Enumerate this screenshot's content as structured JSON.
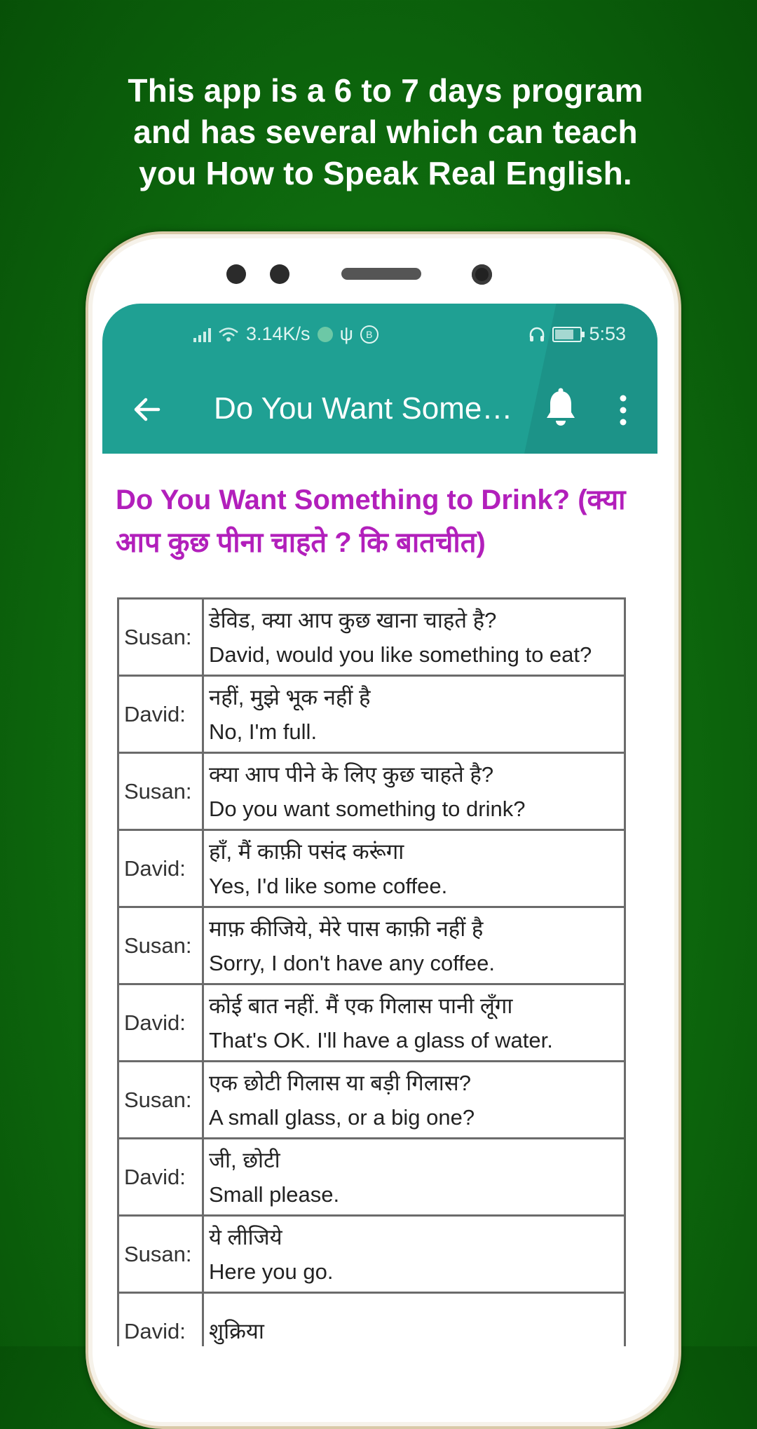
{
  "promo": {
    "line1": "This app is a 6 to 7 days program",
    "line2": "and has several which can teach",
    "line3": "you How to Speak Real English."
  },
  "statusbar": {
    "speed": "3.14K/s",
    "time": "5:53",
    "icons": [
      "signal-icon",
      "wifi-icon",
      "vpn-icon",
      "usb-icon",
      "b-icon",
      "headset-icon",
      "battery-icon"
    ]
  },
  "toolbar": {
    "title": "Do You Want Somet...",
    "back_icon": "back-arrow-icon",
    "bell_icon": "bell-icon",
    "menu_icon": "more-vert-icon"
  },
  "content": {
    "heading": "Do You Want Something to Drink? (क्या आप कुछ पीना चाहते ? कि बातचीत)",
    "dialog": [
      {
        "speaker": "Susan:",
        "hindi": "डेविड, क्या आप कुछ खाना चाहते है?",
        "english": "David, would you like something to eat?"
      },
      {
        "speaker": "David:",
        "hindi": "नहीं, मुझे भूक नहीं है",
        "english": "No, I'm full."
      },
      {
        "speaker": "Susan:",
        "hindi": "क्या आप पीने के लिए कुछ चाहते है?",
        "english": "Do you want something to drink?"
      },
      {
        "speaker": "David:",
        "hindi": "हाँ, मैं काफ़ी पसंद करूंगा",
        "english": "Yes, I'd like some coffee."
      },
      {
        "speaker": "Susan:",
        "hindi": "माफ़ कीजिये, मेरे पास काफ़ी नहीं है",
        "english": "Sorry, I don't have any coffee."
      },
      {
        "speaker": "David:",
        "hindi": "कोई बात नहीं. मैं एक गिलास पानी लूँगा",
        "english": "That's OK. I'll have a glass of water."
      },
      {
        "speaker": "Susan:",
        "hindi": "एक छोटी गिलास या बड़ी गिलास?",
        "english": "A small glass, or a big one?"
      },
      {
        "speaker": "David:",
        "hindi": "जी, छोटी",
        "english": "Small please."
      },
      {
        "speaker": "Susan:",
        "hindi": "ये लीजिये",
        "english": "Here you go."
      },
      {
        "speaker": "David:",
        "hindi": "शुक्रिया",
        "english": ""
      }
    ]
  },
  "colors": {
    "background": "#0f6e0f",
    "appbar": "#1fa093",
    "heading": "#b21fbb",
    "table_border": "#6b6b6b"
  }
}
